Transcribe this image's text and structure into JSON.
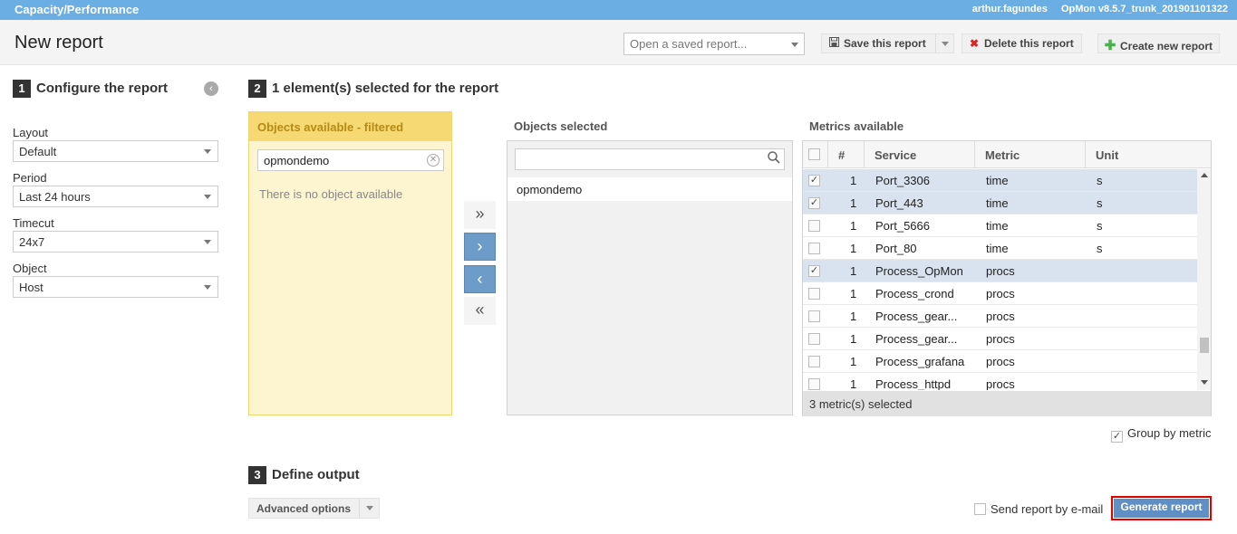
{
  "topbar": {
    "title": "Capacity/Performance",
    "user": "arthur.fagundes",
    "version": "OpMon v8.5.7_trunk_201901101322"
  },
  "header": {
    "page_title": "New report",
    "saved_report_placeholder": "Open a saved report...",
    "save_label": "Save this report",
    "delete_label": "Delete this report",
    "create_label": "Create new report"
  },
  "step1": {
    "num": "1",
    "title": "Configure the report",
    "fields": [
      {
        "label": "Layout",
        "value": "Default"
      },
      {
        "label": "Period",
        "value": "Last 24 hours"
      },
      {
        "label": "Timecut",
        "value": "24x7"
      },
      {
        "label": "Object",
        "value": "Host"
      }
    ]
  },
  "step2": {
    "num": "2",
    "title": "1 element(s) selected for the report",
    "available": {
      "header": "Objects available - filtered",
      "filter_value": "opmondemo",
      "empty_text": "There is no object available"
    },
    "move": {
      "all_right": "»",
      "right": "›",
      "left": "‹",
      "all_left": "«"
    },
    "selected": {
      "header": "Objects selected",
      "items": [
        "opmondemo"
      ]
    },
    "metrics": {
      "header": "Metrics available",
      "columns": {
        "num": "#",
        "service": "Service",
        "metric": "Metric",
        "unit": "Unit"
      },
      "rows": [
        {
          "checked": true,
          "num": "1",
          "service": "Port_3306",
          "metric": "time",
          "unit": "s"
        },
        {
          "checked": true,
          "num": "1",
          "service": "Port_443",
          "metric": "time",
          "unit": "s"
        },
        {
          "checked": false,
          "num": "1",
          "service": "Port_5666",
          "metric": "time",
          "unit": "s"
        },
        {
          "checked": false,
          "num": "1",
          "service": "Port_80",
          "metric": "time",
          "unit": "s"
        },
        {
          "checked": true,
          "num": "1",
          "service": "Process_OpMon",
          "metric": "procs",
          "unit": ""
        },
        {
          "checked": false,
          "num": "1",
          "service": "Process_crond",
          "metric": "procs",
          "unit": ""
        },
        {
          "checked": false,
          "num": "1",
          "service": "Process_gear...",
          "metric": "procs",
          "unit": ""
        },
        {
          "checked": false,
          "num": "1",
          "service": "Process_gear...",
          "metric": "procs",
          "unit": ""
        },
        {
          "checked": false,
          "num": "1",
          "service": "Process_grafana",
          "metric": "procs",
          "unit": ""
        },
        {
          "checked": false,
          "num": "1",
          "service": "Process_httpd",
          "metric": "procs",
          "unit": ""
        }
      ],
      "footer": "3 metric(s) selected"
    },
    "group_by_metric": "Group by metric"
  },
  "step3": {
    "num": "3",
    "title": "Define output",
    "advanced_label": "Advanced options",
    "send_email_label": "Send report by e-mail",
    "generate_label": "Generate report"
  },
  "colors": {
    "topbar": "#6aaee3",
    "accent_blue": "#5f8fc4",
    "highlight": "#e00000",
    "available_panel": "#f6d972"
  }
}
